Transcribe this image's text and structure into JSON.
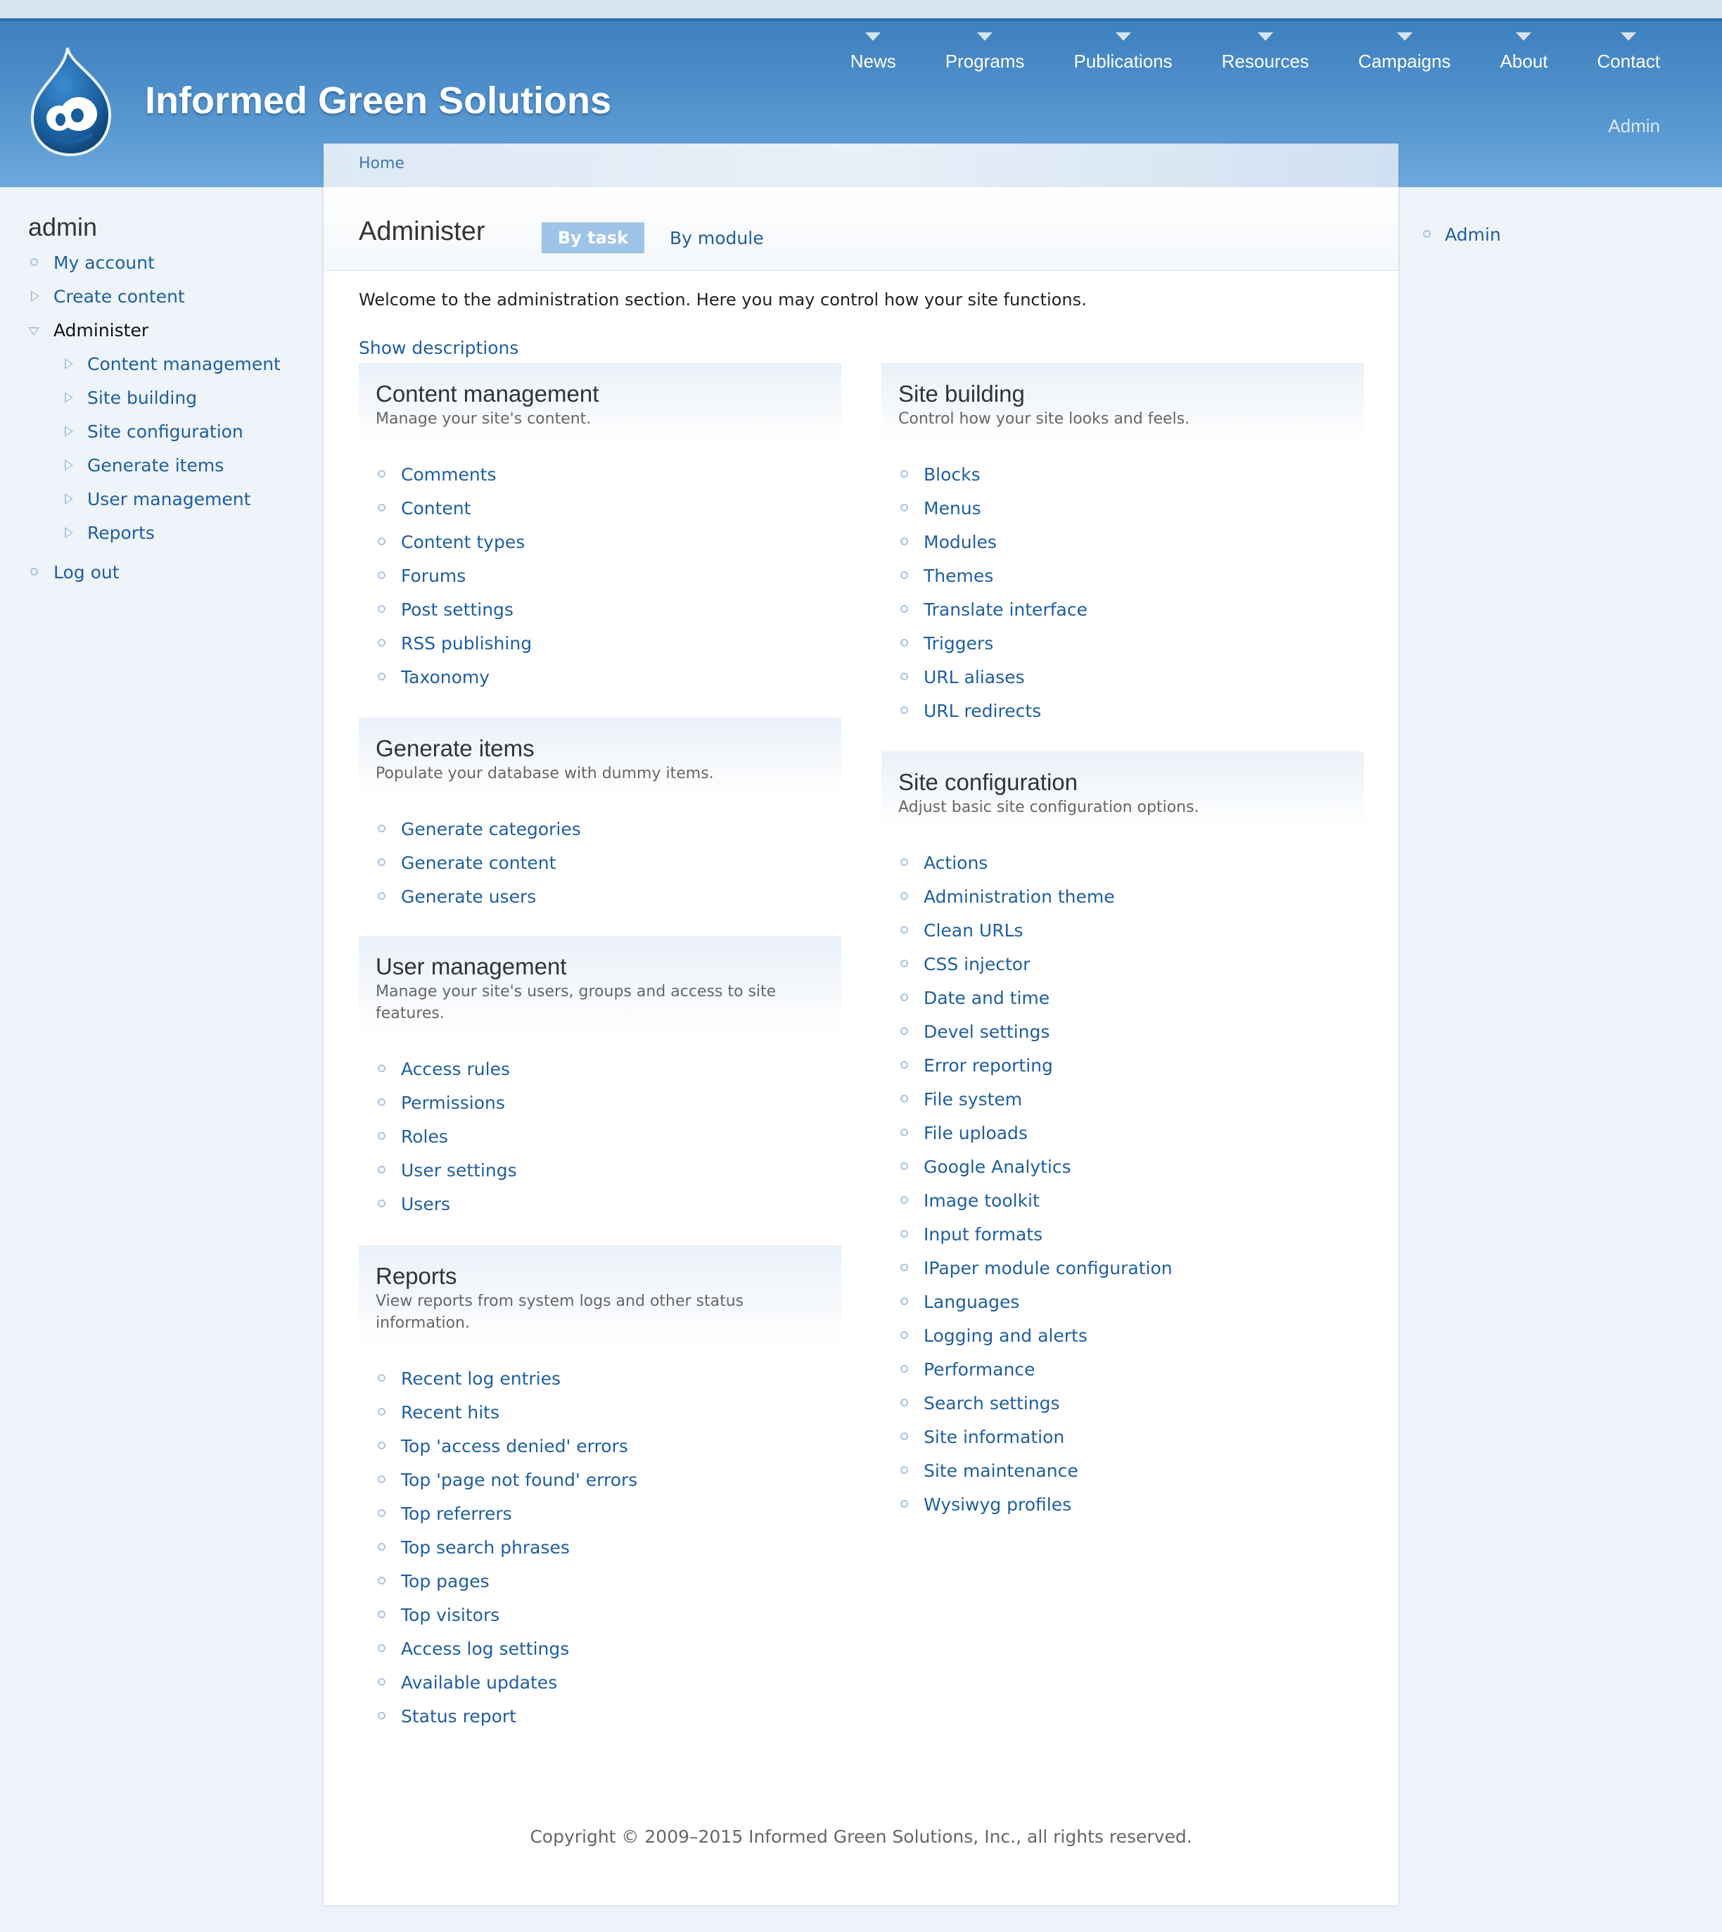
{
  "site": {
    "name": "Informed Green Solutions",
    "colors": {
      "header": "#4a8bc8",
      "link": "#1f5e9e",
      "tab_active": "#9ec4e8"
    },
    "logo_icon": "drupal-drop-logo"
  },
  "primary_nav": [
    "News",
    "Programs",
    "Publications",
    "Resources",
    "Campaigns",
    "About",
    "Contact"
  ],
  "secondary_nav": {
    "admin": "Admin"
  },
  "breadcrumb": {
    "home": "Home"
  },
  "page": {
    "title": "Administer",
    "tabs": {
      "by_task": "By task",
      "by_module": "By module"
    },
    "intro": "Welcome to the administration section. Here you may control how your site functions.",
    "show_descriptions": "Show descriptions"
  },
  "blocks": {
    "content_management": {
      "title": "Content management",
      "description": "Manage your site's content.",
      "items": [
        "Comments",
        "Content",
        "Content types",
        "Forums",
        "Post settings",
        "RSS publishing",
        "Taxonomy"
      ]
    },
    "generate_items": {
      "title": "Generate items",
      "description": "Populate your database with dummy items.",
      "items": [
        "Generate categories",
        "Generate content",
        "Generate users"
      ]
    },
    "user_management": {
      "title": "User management",
      "description": "Manage your site's users, groups and access to site features.",
      "items": [
        "Access rules",
        "Permissions",
        "Roles",
        "User settings",
        "Users"
      ]
    },
    "reports": {
      "title": "Reports",
      "description": "View reports from system logs and other status information.",
      "items": [
        "Recent log entries",
        "Recent hits",
        "Top 'access denied' errors",
        "Top 'page not found' errors",
        "Top referrers",
        "Top search phrases",
        "Top pages",
        "Top visitors",
        "Access log settings",
        "Available updates",
        "Status report"
      ]
    },
    "site_building": {
      "title": "Site building",
      "description": "Control how your site looks and feels.",
      "items": [
        "Blocks",
        "Menus",
        "Modules",
        "Themes",
        "Translate interface",
        "Triggers",
        "URL aliases",
        "URL redirects"
      ]
    },
    "site_configuration": {
      "title": "Site configuration",
      "description": "Adjust basic site configuration options.",
      "items": [
        "Actions",
        "Administration theme",
        "Clean URLs",
        "CSS injector",
        "Date and time",
        "Devel settings",
        "Error reporting",
        "File system",
        "File uploads",
        "Google Analytics",
        "Image toolkit",
        "Input formats",
        "IPaper module configuration",
        "Languages",
        "Logging and alerts",
        "Performance",
        "Search settings",
        "Site information",
        "Site maintenance",
        "Wysiwyg profiles"
      ]
    }
  },
  "left_sidebar": {
    "title": "admin",
    "items": [
      {
        "label": "My account",
        "icon": "circle-bullet-icon"
      },
      {
        "label": "Create content",
        "icon": "collapsed-arrow-icon"
      },
      {
        "label": "Administer",
        "icon": "expanded-arrow-icon"
      }
    ],
    "subitems": [
      "Content management",
      "Site building",
      "Site configuration",
      "Generate items",
      "User management",
      "Reports"
    ],
    "logout": "Log out"
  },
  "right_sidebar": {
    "items": [
      "Admin"
    ]
  },
  "footer": {
    "copyright": "Copyright © 2009–2015 Informed Green Solutions, Inc., all rights reserved."
  }
}
